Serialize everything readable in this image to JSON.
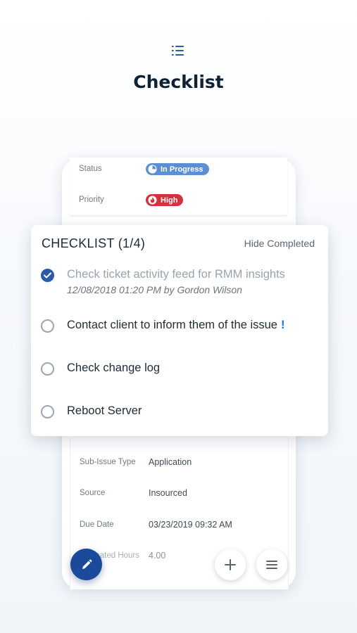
{
  "header": {
    "icon": "checklist-icon",
    "title": "Checklist"
  },
  "ticket": {
    "status_label": "Status",
    "status_value": "In Progress",
    "priority_label": "Priority",
    "priority_value": "High",
    "fields": [
      {
        "label": "Sub-Issue Type",
        "value": "Application"
      },
      {
        "label": "Source",
        "value": "Insourced"
      },
      {
        "label": "Due Date",
        "value": "03/23/2019 09:32 AM"
      },
      {
        "label": "Estimated Hours",
        "value": "4.00"
      }
    ]
  },
  "checklist": {
    "title": "CHECKLIST (1/4)",
    "hide_completed_label": "Hide Completed",
    "items": [
      {
        "text": "Check ticket activity feed for RMM insights",
        "completed": true,
        "meta": "12/08/2018 01:20 PM by Gordon Wilson"
      },
      {
        "text": "Contact client to inform them of the issue",
        "completed": false,
        "important": "!"
      },
      {
        "text": "Check change log",
        "completed": false
      },
      {
        "text": "Reboot Server",
        "completed": false
      }
    ]
  },
  "actions": {
    "edit_icon": "pencil-icon",
    "add_icon": "plus-icon",
    "menu_icon": "menu-icon"
  },
  "colors": {
    "accent": "#2b5ba8",
    "fab": "#1c4a9a",
    "in_progress": "#5b8fd2",
    "high": "#d6303d",
    "important": "#1b6fd0"
  }
}
